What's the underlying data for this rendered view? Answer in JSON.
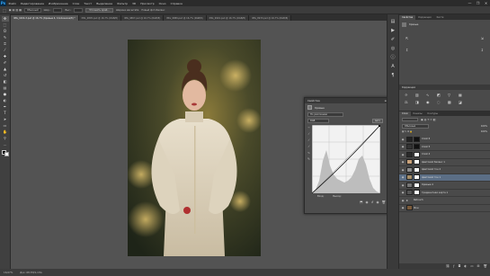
{
  "menubar": {
    "logo": "Ps",
    "items": [
      "Файл",
      "Редактирование",
      "Изображение",
      "Слои",
      "Текст",
      "Выделение",
      "Фильтр",
      "3D",
      "Просмотр",
      "Окно",
      "Справка"
    ],
    "controls": [
      "—",
      "❐",
      "✕"
    ]
  },
  "options_bar": {
    "mode_value": "Обычный",
    "width_label": "Шир.:",
    "height_label": "Выс.:",
    "refine_button": "Уточнить край...",
    "field3": "Ширина масштаба",
    "field4": "Новый фотобаланс"
  },
  "doc_tabs": [
    {
      "label": "IMG_1004-3.psd @ 16,7% (Кривые 4, Слой-маска/8) *",
      "active": true
    },
    {
      "label": "IMG_9805.psd @ 16,7% (RGB/8)",
      "active": false
    },
    {
      "label": "IMG_9867.psd @ 16,7% (RGB/8)",
      "active": false
    },
    {
      "label": "IMG_9889.psd @ 16,7% (RGB/8)",
      "active": false
    },
    {
      "label": "IMG_9901.psd @ 16,7% (RGB/8)",
      "active": false
    },
    {
      "label": "IMG_9933.psd @ 16,7% (RGB/8)",
      "active": false
    }
  ],
  "toolbar": {
    "tools": [
      {
        "icon": "move-icon",
        "glyph": "✥"
      },
      {
        "icon": "marquee-icon",
        "glyph": "⬚"
      },
      {
        "icon": "lasso-icon",
        "glyph": "ʘ"
      },
      {
        "icon": "quick-select-icon",
        "glyph": "✎"
      },
      {
        "icon": "crop-icon",
        "glyph": "⌗"
      },
      {
        "icon": "eyedropper-icon",
        "glyph": "⁄"
      },
      {
        "icon": "healing-brush-icon",
        "glyph": "✚"
      },
      {
        "icon": "brush-icon",
        "glyph": "✐"
      },
      {
        "icon": "clone-stamp-icon",
        "glyph": "▲"
      },
      {
        "icon": "history-brush-icon",
        "glyph": "↺"
      },
      {
        "icon": "eraser-icon",
        "glyph": "◧"
      },
      {
        "icon": "gradient-icon",
        "glyph": "▤"
      },
      {
        "icon": "blur-icon",
        "glyph": "●"
      },
      {
        "icon": "dodge-icon",
        "glyph": "◐"
      },
      {
        "icon": "pen-icon",
        "glyph": "✒"
      },
      {
        "icon": "type-icon",
        "glyph": "T"
      },
      {
        "icon": "path-select-icon",
        "glyph": "➤"
      },
      {
        "icon": "rectangle-shape-icon",
        "glyph": "▭"
      },
      {
        "icon": "hand-icon",
        "glyph": "✋"
      },
      {
        "icon": "zoom-icon",
        "glyph": "⚲"
      },
      {
        "icon": "more-tools-icon",
        "glyph": "…"
      }
    ]
  },
  "status_bar": {
    "zoom": "16,67%",
    "doc_info": "Док: 68,7M/1,13G"
  },
  "right_panel": {
    "top_tabs": [
      "Свойства",
      "Коррекция",
      "Кисти"
    ],
    "curves_props_label": "Кривые",
    "adjust_tab": "Коррекция",
    "layers_tabs": [
      "Слои",
      "Каналы",
      "Контуры"
    ],
    "blend_mode": "Обычные",
    "opacity": "100%",
    "fill": "100%",
    "layers": [
      {
        "name": "Слой 6",
        "thumb": "#222",
        "mask": "#111",
        "selected": false,
        "folder": false
      },
      {
        "name": "Слой 5",
        "thumb": "#333",
        "mask": "#111",
        "selected": false,
        "folder": false
      },
      {
        "name": "Слой 4",
        "thumb": "#2a2a2a",
        "mask": "#fff",
        "selected": false,
        "folder": false
      },
      {
        "name": "Цветовой баланс 1",
        "thumb": "#c9a27a",
        "mask": "#fff",
        "selected": false,
        "folder": false
      },
      {
        "name": "Цветовой тон 2",
        "thumb": "#8c8c8c",
        "mask": "#fff",
        "selected": false,
        "folder": false
      },
      {
        "name": "Цветовой тон 1",
        "thumb": "#a68f6a",
        "mask": "#fff",
        "selected": true,
        "folder": false
      },
      {
        "name": "Кривые 4",
        "thumb": "#777",
        "mask": "#fff",
        "selected": false,
        "folder": false
      },
      {
        "name": "Градиентная карта 1",
        "thumb": "#555",
        "mask": "#fff",
        "selected": false,
        "folder": false
      },
      {
        "name": "Retouch",
        "thumb": "",
        "mask": "",
        "selected": false,
        "folder": true
      },
      {
        "name": "Фон",
        "thumb": "#7a5a3a",
        "mask": "",
        "selected": false,
        "folder": false
      }
    ]
  },
  "curves_dialog": {
    "title": "Свойства",
    "subtitle": "Кривые",
    "preset_label": "По умолчанию",
    "channel": "RGB",
    "auto_button": "Авто",
    "input_label": "Вход:",
    "output_label": "Выход:"
  }
}
